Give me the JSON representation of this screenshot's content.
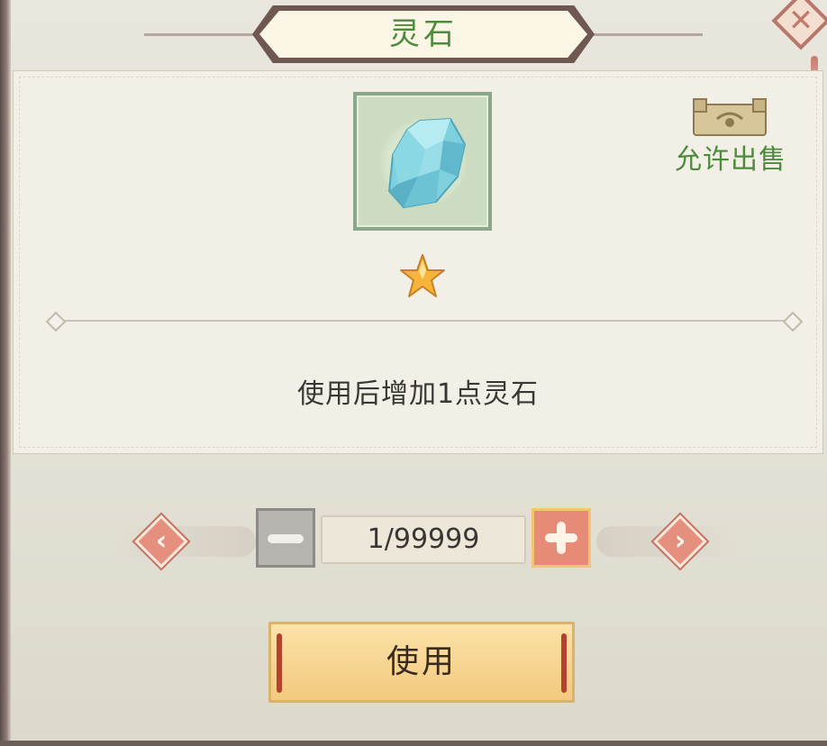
{
  "dialog": {
    "title": "灵石",
    "close_icon": "close-icon",
    "accent_green": "#4e8a3b",
    "accent_red": "#e58b78"
  },
  "item": {
    "icon": "blue-crystal-icon",
    "stars": 1,
    "sell_icon": "treasure-chest-icon",
    "sell_label": "允许出售",
    "description": "使用后增加1点灵石"
  },
  "quantity": {
    "display": "1/99999",
    "min_label_icon": "minus-icon",
    "plus_label_icon": "plus-icon",
    "prev_icon": "arrow-left-icon",
    "next_icon": "arrow-right-icon"
  },
  "actions": {
    "use_label": "使用"
  }
}
